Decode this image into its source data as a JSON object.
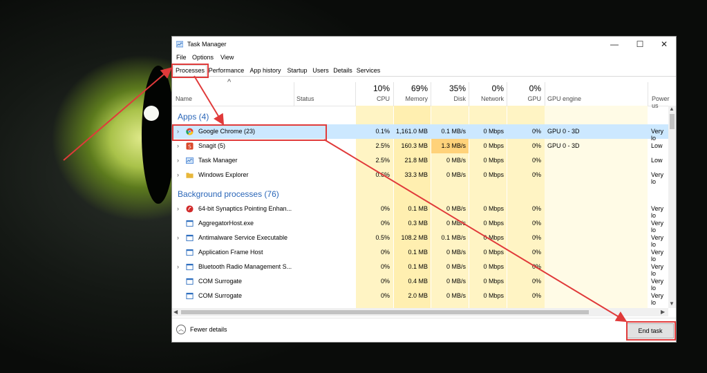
{
  "window": {
    "title": "Task Manager",
    "controls": [
      "—",
      "☐",
      "✕"
    ]
  },
  "menu": [
    "File",
    "Options",
    "View"
  ],
  "tabs": [
    "Processes",
    "Performance",
    "App history",
    "Startup",
    "Users",
    "Details",
    "Services"
  ],
  "columns": {
    "name": "Name",
    "status": "Status",
    "cpu": {
      "pct": "10%",
      "label": "CPU"
    },
    "memory": {
      "pct": "69%",
      "label": "Memory"
    },
    "disk": {
      "pct": "35%",
      "label": "Disk"
    },
    "network": {
      "pct": "0%",
      "label": "Network"
    },
    "gpu": {
      "pct": "0%",
      "label": "GPU"
    },
    "gpu_engine": "GPU engine",
    "power": "Power us"
  },
  "groups": {
    "apps": "Apps (4)",
    "background": "Background processes (76)"
  },
  "apps": [
    {
      "name": "Google Chrome (23)",
      "cpu": "0.1%",
      "mem": "1,161.0 MB",
      "disk": "0.1 MB/s",
      "net": "0 Mbps",
      "gpu": "0%",
      "eng": "GPU 0 - 3D",
      "pwr": "Very lo",
      "icon": "chrome-icon",
      "color": "#e34133"
    },
    {
      "name": "Snagit (5)",
      "cpu": "2.5%",
      "mem": "160.3 MB",
      "disk": "1.3 MB/s",
      "net": "0 Mbps",
      "gpu": "0%",
      "eng": "GPU 0 - 3D",
      "pwr": "Low",
      "icon": "snagit-icon",
      "color": "#d9482b"
    },
    {
      "name": "Task Manager",
      "cpu": "2.5%",
      "mem": "21.8 MB",
      "disk": "0 MB/s",
      "net": "0 Mbps",
      "gpu": "0%",
      "eng": "",
      "pwr": "Low",
      "icon": "task-manager-icon",
      "color": "#3a7bd5"
    },
    {
      "name": "Windows Explorer",
      "cpu": "0.6%",
      "mem": "33.3 MB",
      "disk": "0 MB/s",
      "net": "0 Mbps",
      "gpu": "0%",
      "eng": "",
      "pwr": "Very lo",
      "icon": "folder-icon",
      "color": "#e8b73a"
    }
  ],
  "background": [
    {
      "name": "64-bit Synaptics Pointing Enhan...",
      "cpu": "0%",
      "mem": "0.1 MB",
      "disk": "0 MB/s",
      "net": "0 Mbps",
      "gpu": "0%",
      "pwr": "Very lo",
      "icon": "synaptics-icon",
      "color": "#d12a2a"
    },
    {
      "name": "AggregatorHost.exe",
      "cpu": "0%",
      "mem": "0.3 MB",
      "disk": "0 MB/s",
      "net": "0 Mbps",
      "gpu": "0%",
      "pwr": "Very lo",
      "icon": "app-window-icon",
      "color": "#2f6fbf"
    },
    {
      "name": "Antimalware Service Executable",
      "cpu": "0.5%",
      "mem": "108.2 MB",
      "disk": "0.1 MB/s",
      "net": "0 Mbps",
      "gpu": "0%",
      "pwr": "Very lo",
      "icon": "app-window-icon",
      "color": "#2f6fbf"
    },
    {
      "name": "Application Frame Host",
      "cpu": "0%",
      "mem": "0.1 MB",
      "disk": "0 MB/s",
      "net": "0 Mbps",
      "gpu": "0%",
      "pwr": "Very lo",
      "icon": "app-window-icon",
      "color": "#2f6fbf"
    },
    {
      "name": "Bluetooth Radio Management S...",
      "cpu": "0%",
      "mem": "0.1 MB",
      "disk": "0 MB/s",
      "net": "0 Mbps",
      "gpu": "0%",
      "pwr": "Very lo",
      "icon": "app-window-icon",
      "color": "#2f6fbf"
    },
    {
      "name": "COM Surrogate",
      "cpu": "0%",
      "mem": "0.4 MB",
      "disk": "0 MB/s",
      "net": "0 Mbps",
      "gpu": "0%",
      "pwr": "Very lo",
      "icon": "app-window-icon",
      "color": "#2f6fbf"
    },
    {
      "name": "COM Surrogate",
      "cpu": "0%",
      "mem": "2.0 MB",
      "disk": "0 MB/s",
      "net": "0 Mbps",
      "gpu": "0%",
      "pwr": "Very lo",
      "icon": "app-window-icon",
      "color": "#2f6fbf"
    }
  ],
  "footer": {
    "fewer_details": "Fewer details",
    "end_task": "End task"
  },
  "colors": {
    "accent": "#2a66b8",
    "highlight": "#e03a3a",
    "selected": "#cce8ff"
  }
}
